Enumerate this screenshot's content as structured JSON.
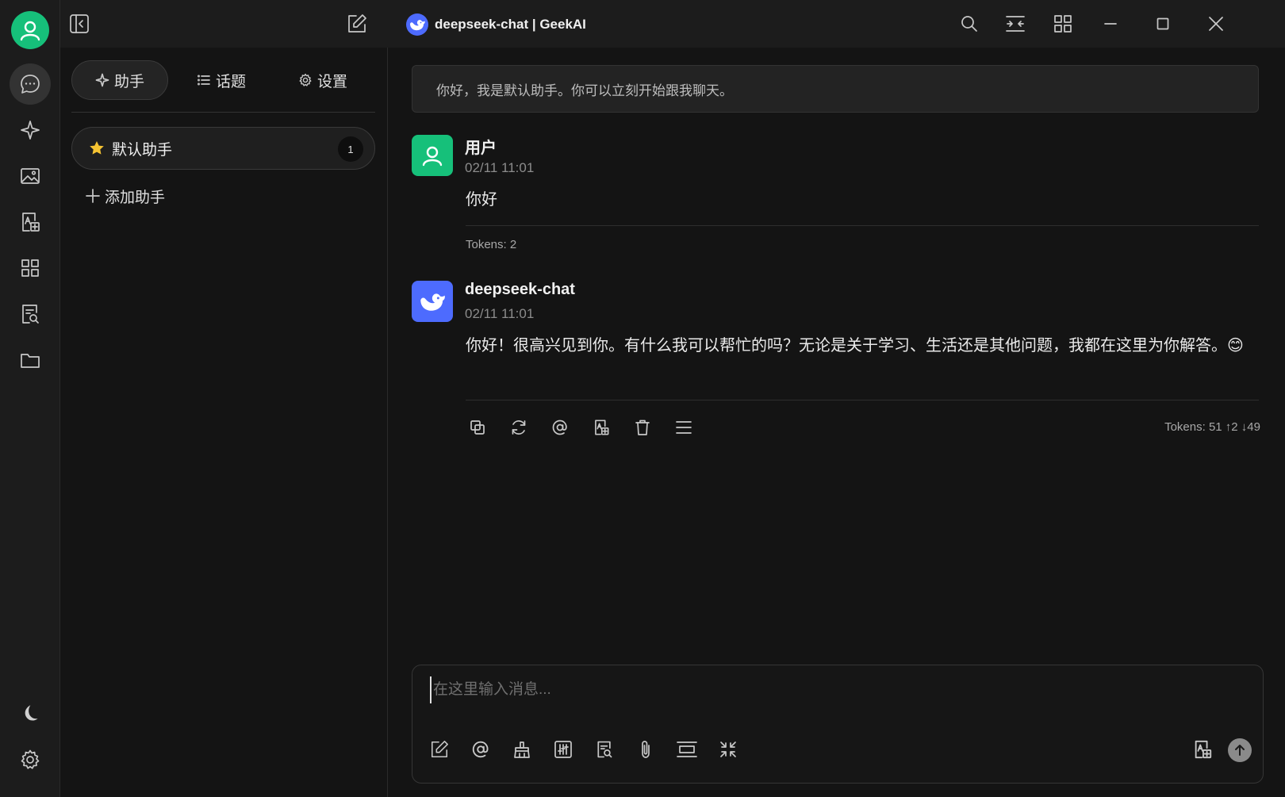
{
  "window": {
    "title": "deepseek-chat | GeekAI"
  },
  "rail": {
    "items": [
      {
        "icon": "chat-bubble-icon",
        "active": true
      },
      {
        "icon": "sparkle-icon"
      },
      {
        "icon": "image-icon"
      },
      {
        "icon": "translate-icon"
      },
      {
        "icon": "apps-grid-icon"
      },
      {
        "icon": "document-search-icon"
      },
      {
        "icon": "folder-icon"
      }
    ],
    "bottom": [
      {
        "icon": "moon-icon"
      },
      {
        "icon": "gear-icon"
      }
    ]
  },
  "sidebar": {
    "tabs": [
      {
        "label": "助手",
        "icon": "sparkle-icon",
        "active": true
      },
      {
        "label": "话题",
        "icon": "list-icon"
      },
      {
        "label": "设置",
        "icon": "gear-icon"
      }
    ],
    "assistant": {
      "label": "默认助手",
      "count": "1"
    },
    "add_label": "添加助手"
  },
  "chat": {
    "system_message": "你好，我是默认助手。你可以立刻开始跟我聊天。",
    "messages": [
      {
        "role": "user",
        "name": "用户",
        "time": "02/11 11:01",
        "content": "你好",
        "tokens": "Tokens: 2"
      },
      {
        "role": "assistant",
        "name": "deepseek-chat",
        "time": "02/11 11:01",
        "content": "你好！很高兴见到你。有什么我可以帮忙的吗？无论是关于学习、生活还是其他问题，我都在这里为你解答。😊",
        "tokens": "Tokens: 51 ↑2 ↓49"
      }
    ]
  },
  "input": {
    "placeholder": "在这里输入消息..."
  },
  "colors": {
    "accent_green": "#16c07a",
    "deepseek_blue": "#4d6bfe",
    "background": "#141414"
  }
}
